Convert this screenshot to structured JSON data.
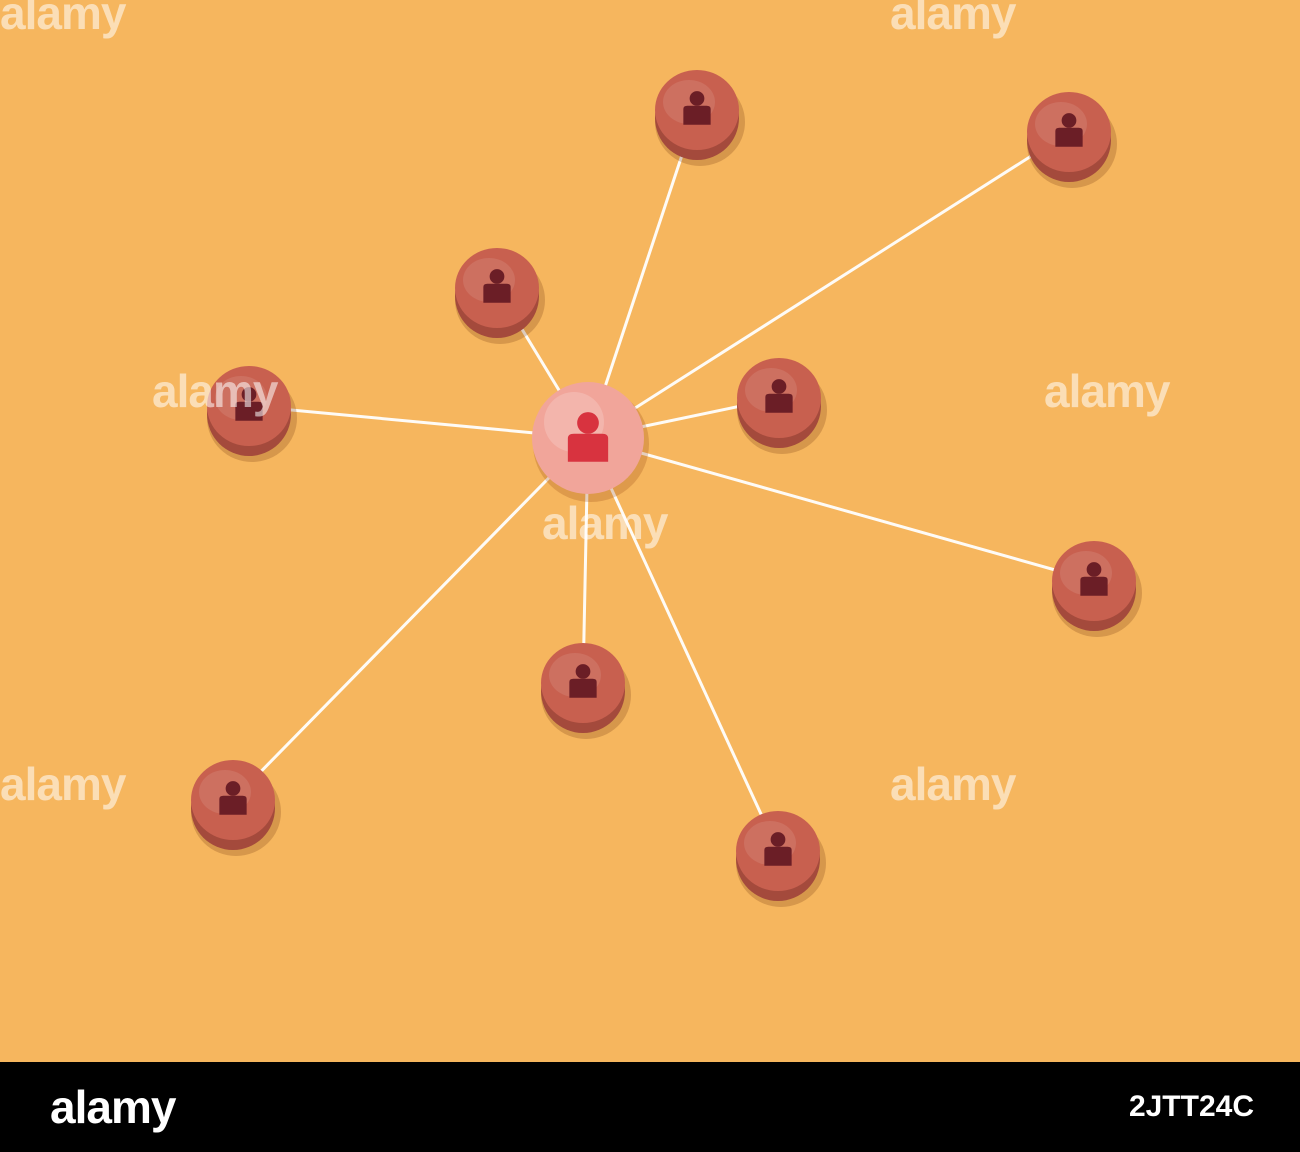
{
  "photo": {
    "background_color": "#F6B65E",
    "hub": {
      "icon": "person-icon",
      "color": "#D8333F",
      "ball_color": "#F1A59A"
    },
    "nodes_icon": "person-icon",
    "node_wood_color": "#C8604F",
    "node_icon_color": "#6B1E26",
    "link_color": "#FFFFFF",
    "node_count": 10
  },
  "watermark": {
    "text": "alamy"
  },
  "footer": {
    "brand": "alamy",
    "stock_id": "2JTT24C"
  }
}
